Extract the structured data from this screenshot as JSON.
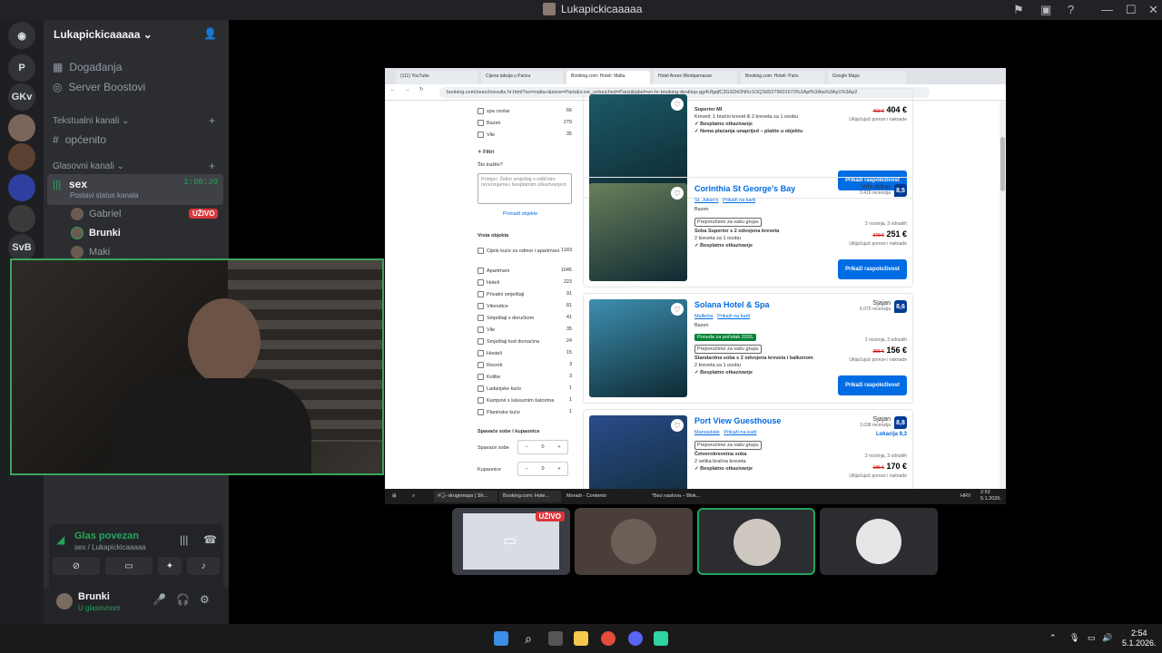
{
  "window": {
    "title": "Lukapickicaaaaa"
  },
  "guilds": [
    "P",
    "GKv",
    "SvB"
  ],
  "server": {
    "name": "Lukapickicaaaaa",
    "top_items": [
      {
        "label": "Događanja"
      },
      {
        "label": "Server Boostovi"
      }
    ],
    "text_category": "Tekstualni kanali",
    "text_channels": [
      {
        "label": "općenito"
      }
    ],
    "voice_category": "Glasovni kanali",
    "voice_channel": {
      "name": "sex",
      "timer": "1:00:39",
      "status": "Postavi status kanala"
    },
    "members": [
      {
        "name": "Gabriel",
        "badge": "UŽIVO"
      },
      {
        "name": "Brunki",
        "badge": ""
      },
      {
        "name": "Maki",
        "badge": ""
      }
    ]
  },
  "voice_panel": {
    "status": "Glas povezan",
    "channel": "sex / Lukapickicaaaaa"
  },
  "user": {
    "name": "Brunki",
    "status": "U glasovnom"
  },
  "browser": {
    "tabs": [
      "(111) YouTube",
      "Cijena taksija u Parizu",
      "Booking.com: Hoteli: Malta",
      "Hotel Arane Montparnasse",
      "Booking.com: Hoteli: Paris",
      "Google Maps"
    ],
    "url": "booking.com/searchresults.hr.html?ss=malta+&ssne=Pariz&ssne_untouched=Pariz&label=en-hr-booking-desktop-gg4UfgqfC3GSDtONRz1OQS65279601673%3Apl%3Ata%3Ap1%3Ap2"
  },
  "filters": {
    "top_items": [
      {
        "label": "spa centar",
        "count": "66"
      },
      {
        "label": "Bazen",
        "count": "279"
      },
      {
        "label": "Vile",
        "count": "35"
      }
    ],
    "ai_title": "Filtri",
    "ai_question": "Što tražite?",
    "ai_placeholder": "Primjer: Želim smještaj s odličnim recenzijama i besplatnim otkazivanjem",
    "ai_button": "Pronađi objekte",
    "type_title": "Vrsta objekta",
    "types": [
      {
        "label": "Cijele kuće za odmor i apartmani",
        "count": "1183"
      },
      {
        "label": "Apartmani",
        "count": "1045"
      },
      {
        "label": "Hoteli",
        "count": "223"
      },
      {
        "label": "Privatni smještaji",
        "count": "91"
      },
      {
        "label": "Vikendice",
        "count": "81"
      },
      {
        "label": "Smještaji s doručkom",
        "count": "41"
      },
      {
        "label": "Vile",
        "count": "35"
      },
      {
        "label": "Smještaji kod domaćina",
        "count": "24"
      },
      {
        "label": "Hosteli",
        "count": "15"
      },
      {
        "label": "Resorti",
        "count": "3"
      },
      {
        "label": "Kolibe",
        "count": "3"
      },
      {
        "label": "Ladanjske kuće",
        "count": "1"
      },
      {
        "label": "Kampovi s luksuznim šatorima",
        "count": "1"
      },
      {
        "label": "Planinske kuće",
        "count": "1"
      }
    ],
    "rooms_title": "Spavaće sobe i kupaonice",
    "bedrooms_label": "Spavaće sobe",
    "bedrooms_value": "0",
    "bathrooms_label": "Kupaonice",
    "bathrooms_value": "0"
  },
  "hotels": [
    {
      "name": "",
      "room": "Superior MI",
      "beds": "Kreveti: 1 bračni krevet ili 2 kreveta za 1 osobu",
      "cancel": "Besplatno otkazivanje",
      "prepay": "Nema plaćanja unaprijed – platite u objektu",
      "old_price": "463 €",
      "price": "404 €",
      "tax": "Uključujući poreze i naknade",
      "button": "Prikaži raspoloživost",
      "img": "#1c5a66"
    },
    {
      "name": "Corinthia St George's Bay",
      "genius": "Genius",
      "location": "St. Julian's",
      "map": "Prikaži na karti",
      "amenity": "Bazen",
      "recommend": "Preporučeno za vašu grupu",
      "room": "Soba Superior s 2 odvojena kreveta",
      "beds": "2 kreveta za 1 osobu",
      "cancel": "Besplatno otkazivanje",
      "nights": "2 noćenja, 3 odraslih",
      "old_price": "279 €",
      "price": "251 €",
      "tax": "Uključujući poreze i naknade",
      "rating_word": "Vrlo dobar",
      "reviews": "3.416 recenzija",
      "score": "8,5",
      "button": "Prikaži raspoloživost",
      "img": "#6a7f5a"
    },
    {
      "name": "Solana Hotel & Spa",
      "genius": "Genius",
      "location": "Mellieha",
      "map": "Prikaži na karti",
      "amenity": "Bazen",
      "promo": "Ponuda za početak 2026.",
      "recommend": "Preporučeno za vašu grupu",
      "room": "Standardna soba s 2 odvojena kreveta i balkonom",
      "beds": "2 kreveta za 1 osobu",
      "cancel": "Besplatno otkazivanje",
      "nights": "2 noćenja, 3 odraslih",
      "old_price": "255 €",
      "price": "156 €",
      "tax": "Uključujući poreze i naknade",
      "rating_word": "Sjajan",
      "reviews": "6.079 recenzija",
      "score": "8,6",
      "button": "Prikaži raspoloživost",
      "img": "#3d8fb0"
    },
    {
      "name": "Port View Guesthouse",
      "genius": "Genius",
      "location": "Marsaxlokk",
      "map": "Prikaži na karti",
      "recommend": "Preporučeno za vašu grupu",
      "room": "Četverokrevetna soba",
      "beds": "2 velika bračna kreveta",
      "cancel": "Besplatno otkazivanje",
      "nights": "2 noćenja, 3 odraslih",
      "old_price": "186 €",
      "price": "170 €",
      "tax": "Uključujući poreze i naknade",
      "rating_word": "Sjajan",
      "reviews": "1.038 recenzija",
      "score": "8,8",
      "location_score": "Lokacija 9,3",
      "button": "Prikaži raspoloživost",
      "img": "#2a4c8a"
    }
  ],
  "win_taskbar": {
    "items": [
      "#🗣-drogemaps | Sh...",
      "Booking.com: Hote...",
      "Moradi - Contento",
      "*Bez naslova – Blok..."
    ],
    "lang": "HRV",
    "time": "2:53",
    "date": "5.1.2026."
  },
  "stream_tiles": {
    "live_badge": "UŽIVO"
  },
  "taskbar": {
    "time": "2:54",
    "date": "5.1.2026."
  }
}
